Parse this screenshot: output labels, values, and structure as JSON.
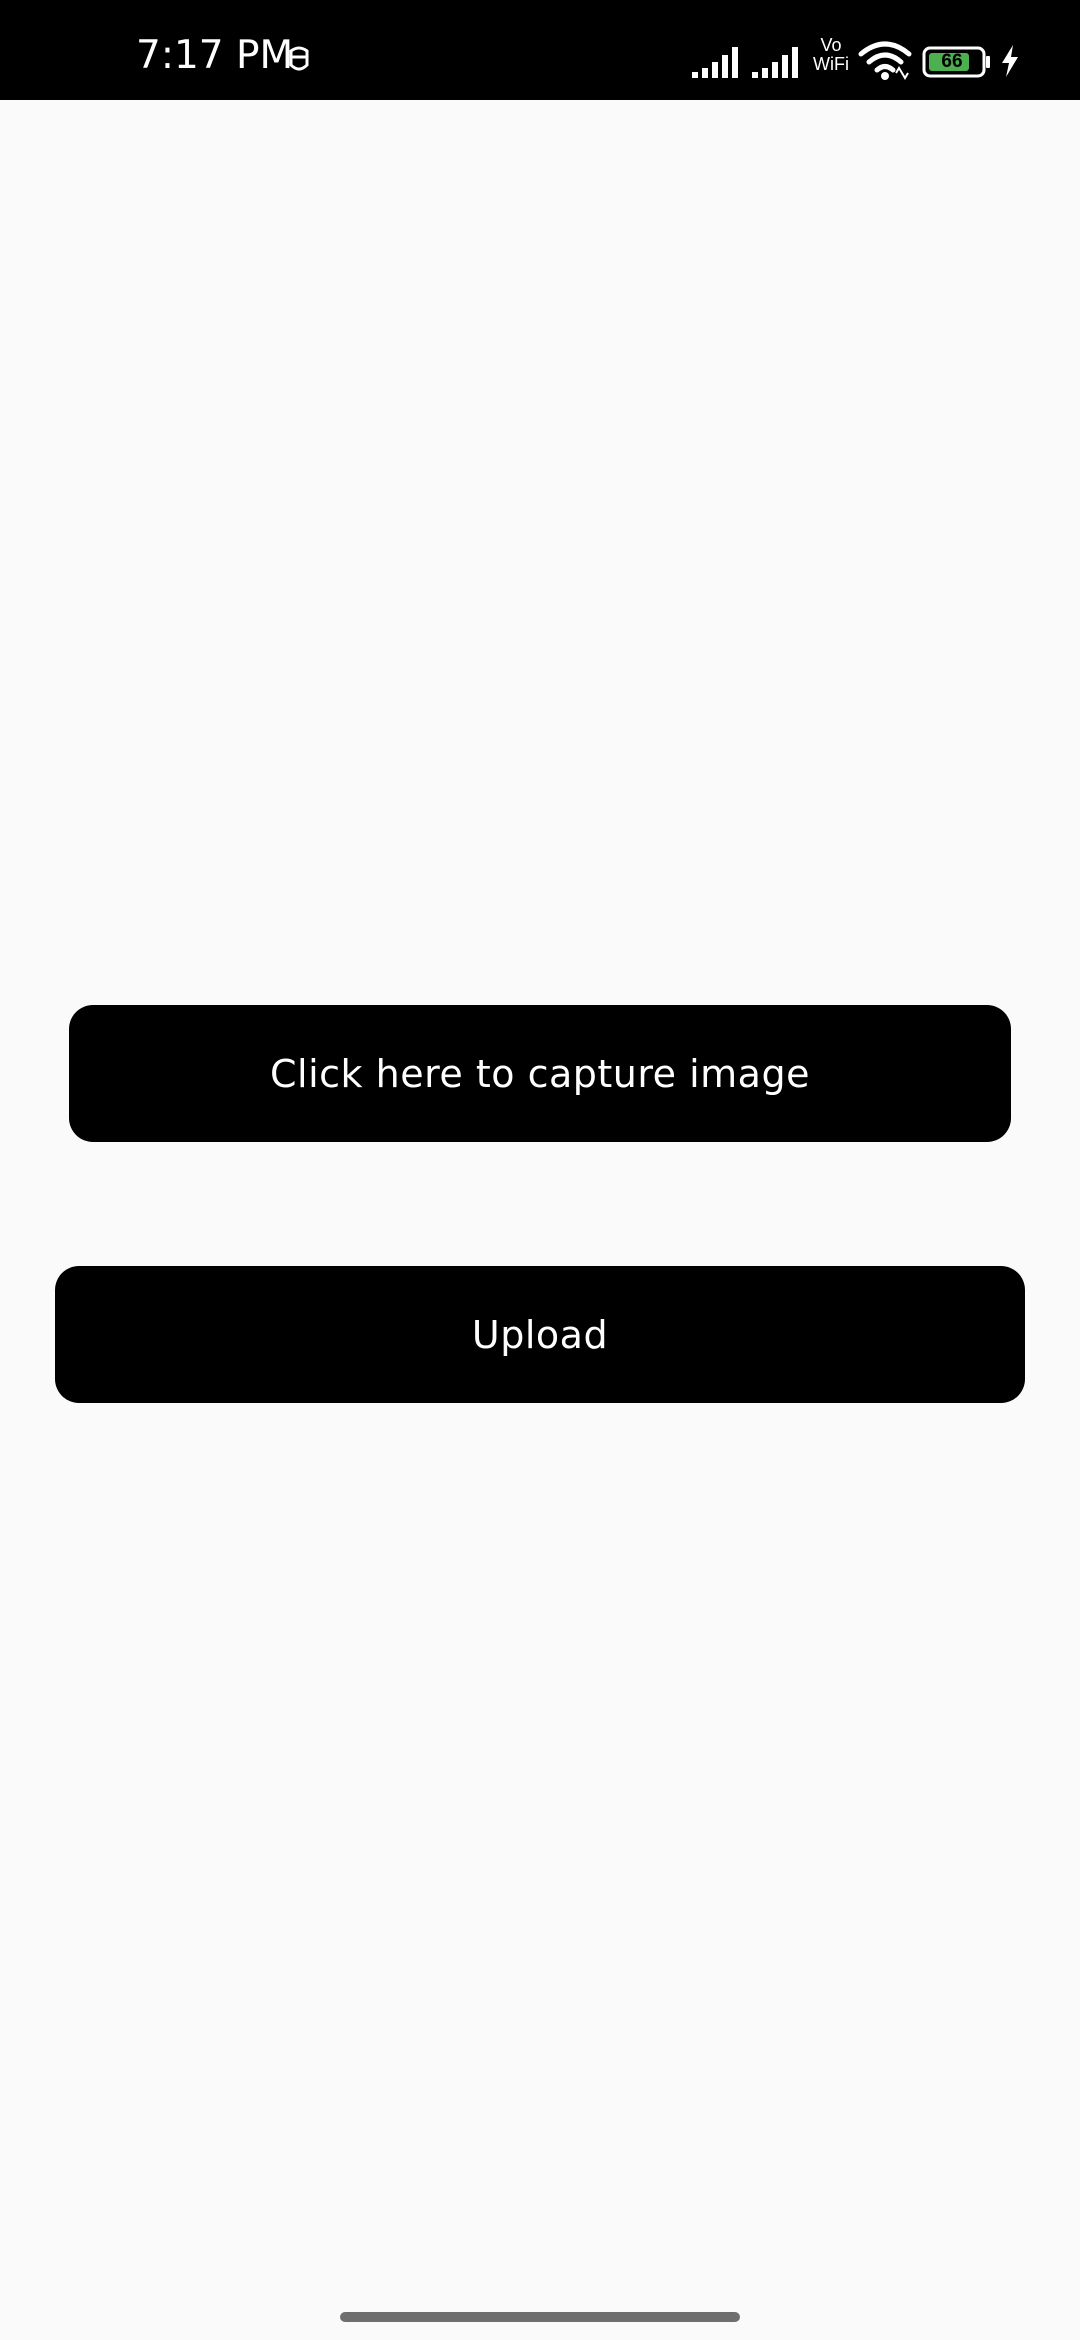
{
  "status_bar": {
    "time": "7:17 PM",
    "vowifi_line1": "Vo",
    "vowifi_line2": "WiFi",
    "battery_level": "66",
    "icons": [
      "mask-icon",
      "signal-icon",
      "signal-icon",
      "wifi-icon",
      "battery-icon",
      "charging-icon"
    ]
  },
  "main": {
    "capture_label": "Click here to capture image",
    "upload_label": "Upload"
  },
  "colors": {
    "background": "#fafafa",
    "button_bg": "#000000",
    "button_text": "#ffffff",
    "battery_fill": "#4caf50"
  }
}
